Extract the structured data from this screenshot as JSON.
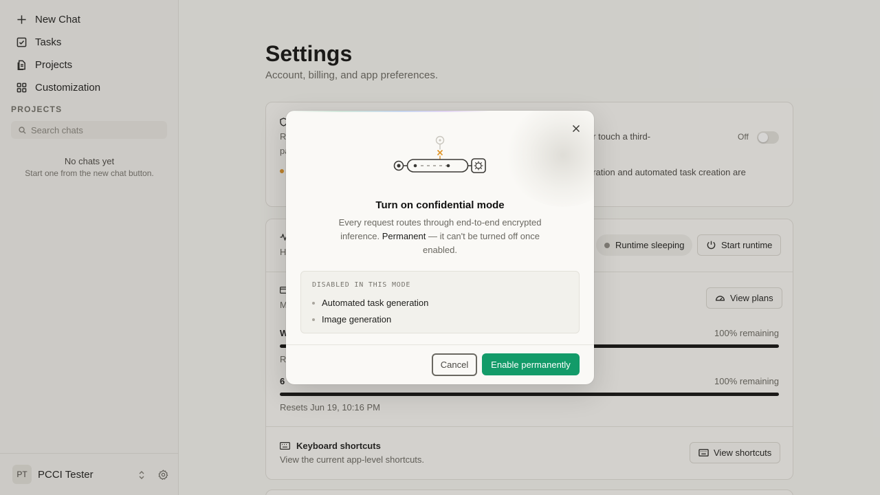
{
  "sidebar": {
    "nav": [
      {
        "label": "New Chat",
        "icon": "plus-icon"
      },
      {
        "label": "Tasks",
        "icon": "checkbox-icon"
      },
      {
        "label": "Projects",
        "icon": "document-icon"
      },
      {
        "label": "Customization",
        "icon": "grid-icon"
      }
    ],
    "section_label": "PROJECTS",
    "search_placeholder": "Search chats",
    "empty_title": "No chats yet",
    "empty_subtitle": "Start one from the new chat button.",
    "user": {
      "initials": "PT",
      "name": "PCCI Tester"
    }
  },
  "main": {
    "title": "Settings",
    "subtitle": "Account, billing, and app preferences.",
    "confidential_card": {
      "text_line1_left": "Re",
      "text_line1_right": "er touch a third-",
      "text_line2_left": "pa",
      "notice_right": "eration and automated task creation are",
      "toggle_label": "Off",
      "toggle_on": false
    },
    "usage_card": {
      "runtime_row_left": "H",
      "runtime_status": "Runtime sleeping",
      "start_runtime_label": "Start runtime",
      "plan_row_left": "M",
      "view_plans_label": "View plans",
      "weekly_label": "W",
      "weekly_remaining": "100% remaining",
      "weekly_reset_left": "Re",
      "six_label": "6",
      "six_remaining": "100% remaining",
      "six_reset": "Resets Jun 19, 10:16 PM",
      "shortcuts_title": "Keyboard shortcuts",
      "shortcuts_desc": "View the current app-level shortcuts.",
      "view_shortcuts_label": "View shortcuts"
    }
  },
  "modal": {
    "title": "Turn on confidential mode",
    "description_before": "Every request routes through end-to-end encrypted inference. ",
    "description_bold": "Permanent",
    "description_after": " — it can't be turned off once enabled.",
    "disabled_heading": "DISABLED IN THIS MODE",
    "disabled_items": [
      "Automated task generation",
      "Image generation"
    ],
    "cancel_label": "Cancel",
    "enable_label": "Enable permanently"
  },
  "colors": {
    "accent_green": "#139b69",
    "illustration_orange": "#e0962a",
    "notice_dot_orange": "#e0962a"
  }
}
